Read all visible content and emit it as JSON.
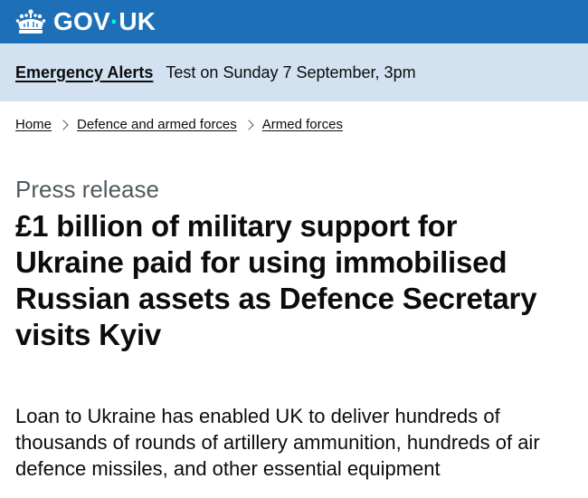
{
  "header": {
    "logo_prefix": "GOV",
    "logo_dot": "·",
    "logo_suffix": "UK",
    "brand_color": "#1d70b8"
  },
  "banner": {
    "link_label": "Emergency Alerts",
    "message": "Test on Sunday 7 September, 3pm",
    "background": "#d2e2f1"
  },
  "breadcrumbs": [
    {
      "label": "Home"
    },
    {
      "label": "Defence and armed forces"
    },
    {
      "label": "Armed forces"
    }
  ],
  "article": {
    "caption": "Press release",
    "title": "£1 billion of military support for Ukraine paid for using immobilised Russian assets as Defence Secretary visits Kyiv",
    "summary": "Loan to Ukraine has enabled UK to deliver hundreds of thousands of rounds of artillery ammunition, hundreds of air defence missiles, and other essential equipment"
  }
}
